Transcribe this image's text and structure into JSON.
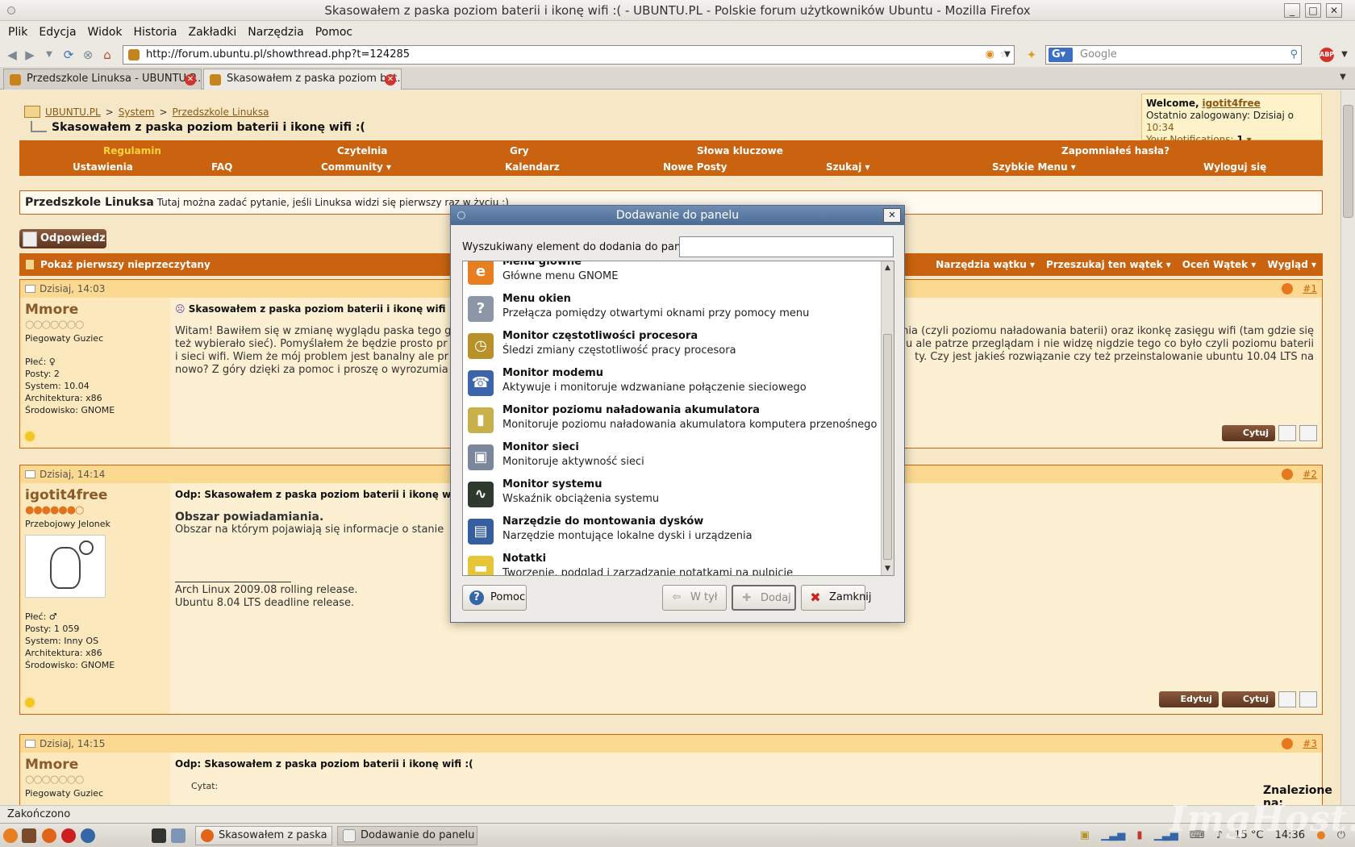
{
  "window": {
    "title": "Skasowałem z paska poziom baterii i ikonę wifi :( - UBUNTU.PL - Polskie forum użytkowników Ubuntu - Mozilla Firefox"
  },
  "menu": [
    "Plik",
    "Edycja",
    "Widok",
    "Historia",
    "Zakładki",
    "Narzędzia",
    "Pomoc"
  ],
  "url": "http://forum.ubuntu.pl/showthread.php?t=124285",
  "search_placeholder": "Google",
  "tabs": [
    {
      "label": "Przedszkole Linuksa - UBUNTU.P..."
    },
    {
      "label": "Skasowałem z paska poziom bat..."
    }
  ],
  "breadcrumb": {
    "site": "UBUNTU.PL",
    "section": "System",
    "forum": "Przedszkole Linuksa",
    "sep": ">",
    "thread_title": "Skasowałem z paska poziom baterii i ikonę wifi :("
  },
  "welcome": {
    "greeting": "Welcome,",
    "username": "igotit4free",
    "last_login_label": "Ostatnio zalogowany: Dzisiaj o",
    "last_login_time": "10:34",
    "notifications_label": "Your Notifications:",
    "notifications_count": "1"
  },
  "navmenu": {
    "row1": [
      "Regulamin",
      "Czytelnia",
      "Gry",
      "Słowa kluczowe",
      "Zapomniałeś hasła?"
    ],
    "row2": [
      "Ustawienia",
      "FAQ",
      "Community ▾",
      "Kalendarz",
      "Nowe Posty",
      "Szukaj ▾",
      "Szybkie Menu ▾",
      "Wyloguj się"
    ]
  },
  "forum_desc": {
    "name": "Przedszkole Linuksa",
    "text": "Tutaj można zadać pytanie, jeśli Linuksa widzi się pierwszy raz w życiu :)"
  },
  "reply_button": "Odpowiedz",
  "threadbar": {
    "first_unread": "Pokaż pierwszy nieprzeczytany",
    "tools": [
      "Narzędzia wątku ▾",
      "Przeszukaj ten wątek ▾",
      "Oceń Wątek ▾",
      "Wygląd ▾"
    ]
  },
  "posts": [
    {
      "date": "Dzisiaj, 14:03",
      "num": "#1",
      "user": "Mmore",
      "rank": "Piegowaty Guziec",
      "info": [
        "Płeć: ♀",
        "Posty: 2",
        "System: 10.04",
        "Architektura: x86",
        "Środowisko: GNOME"
      ],
      "title": "Skasowałem z paska poziom baterii i ikonę wifi :(",
      "body_left": "Witam! Bawiłem się w zmianę wyglądu paska tego g",
      "body_right": "nia (czyli poziomu naładowania baterii) oraz ikonkę zasięgu wifi (tam gdzie się",
      "body_l2": "też wybierało sieć). Pomyślałem że będzie prosto pr",
      "body_r2": "u ale patrze przeglądam i nie widzę nigdzie tego co było czyli poziomu baterii",
      "body_l3": "i sieci wifi. Wiem że mój problem jest banalny ale pr",
      "body_r3": "ty. Czy jest jakieś rozwiązanie czy też przeinstalowanie ubuntu 10.04 LTS na",
      "body_l4": "nowo? Z góry dzięki za pomoc i proszę o wyrozumia",
      "quote_btn": "Cytuj"
    },
    {
      "date": "Dzisiaj, 14:14",
      "num": "#2",
      "user": "igotit4free",
      "rank": "Przebojowy Jelonek",
      "info": [
        "Płeć: ♂",
        "Posty: 1 059",
        "System: Inny OS",
        "Architektura: x86",
        "Środowisko: GNOME"
      ],
      "title": "Odp: Skasowałem z paska poziom baterii i ikonę wifi",
      "heading": "Obszar powiadamiania.",
      "body": "Obszar na którym pojawiają się informacje o stanie",
      "sig1": "Arch Linux 2009.08 rolling release.",
      "sig2": "Ubuntu 8.04 LTS deadline release.",
      "edit_btn": "Edytuj",
      "quote_btn": "Cytuj"
    },
    {
      "date": "Dzisiaj, 14:15",
      "num": "#3",
      "user": "Mmore",
      "rank": "Piegowaty Guziec",
      "title": "Odp: Skasowałem z paska poziom baterii i ikonę wifi :(",
      "quote_label": "Cytat:",
      "found": "Znalezione na:"
    }
  ],
  "status": "Zakończono",
  "taskbar": {
    "tasks": [
      "Skasowałem z paska ...",
      "Dodawanie do panelu"
    ],
    "temp": "15 °C",
    "clock": "14:36",
    "watermark": "ImgHost.pl"
  },
  "dialog": {
    "title": "Dodawanie do panelu",
    "search_label": "Wyszukiwany element do dodania do panelu:",
    "search_value": "",
    "items": [
      {
        "name": "Menu główne",
        "desc": "Główne menu GNOME",
        "icon": "gnome-main-menu-icon",
        "color": "#e77f20",
        "glyph": "e"
      },
      {
        "name": "Menu okien",
        "desc": "Przełącza pomiędzy otwartymi oknami przy pomocy menu",
        "icon": "window-menu-icon",
        "color": "#8b97a6",
        "glyph": "?"
      },
      {
        "name": "Monitor częstotliwości procesora",
        "desc": "Śledzi zmiany częstotliwość pracy procesora",
        "icon": "cpu-frequency-icon",
        "color": "#b8912a",
        "glyph": "◷"
      },
      {
        "name": "Monitor modemu",
        "desc": "Aktywuje i monitoruje wdzwaniane połączenie sieciowego",
        "icon": "modem-phone-icon",
        "color": "#3c64a8",
        "glyph": "☎"
      },
      {
        "name": "Monitor poziomu naładowania akumulatora",
        "desc": "Monitoruje poziomu naładowania akumulatora komputera przenośnego",
        "icon": "battery-icon",
        "color": "#c8b14a",
        "glyph": "▮"
      },
      {
        "name": "Monitor sieci",
        "desc": "Monitoruje aktywność sieci",
        "icon": "network-monitor-icon",
        "color": "#7a879a",
        "glyph": "▣"
      },
      {
        "name": "Monitor systemu",
        "desc": "Wskaźnik obciążenia systemu",
        "icon": "system-monitor-icon",
        "color": "#2e3a2e",
        "glyph": "∿"
      },
      {
        "name": "Narzędzie do montowania dysków",
        "desc": "Narzędzie montujące lokalne dyski i urządzenia",
        "icon": "floppy-disk-icon",
        "color": "#355e9e",
        "glyph": "▤"
      },
      {
        "name": "Notatki",
        "desc": "Tworzenie, podgląd i zarządzanie notatkami na pulpicie",
        "icon": "sticky-notes-icon",
        "color": "#e6c637",
        "glyph": "▬"
      }
    ],
    "help_btn": "Pomoc",
    "back_btn": "W tył",
    "add_btn": "Dodaj",
    "close_btn": "Zamknij"
  }
}
